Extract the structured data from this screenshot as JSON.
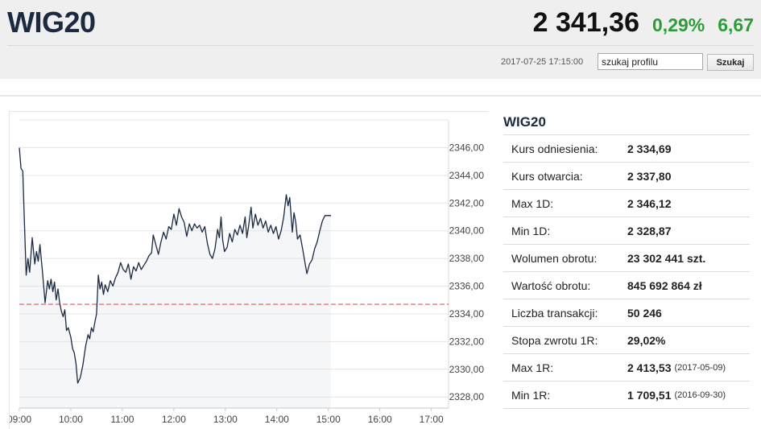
{
  "header": {
    "title": "WIG20",
    "price": "2 341,36",
    "change_pct": "0,29%",
    "change_abs": "6,67",
    "timestamp": "2017-07-25 17:15:00",
    "search": {
      "value": "szukaj profilu",
      "button_label": "Szukaj"
    }
  },
  "colors": {
    "positive": "#2e9b3a",
    "line": "#1b2a41",
    "reference": "#e25b5b",
    "area": "#f4f6f8"
  },
  "chart_data": {
    "type": "line",
    "x_ticks": [
      "09:00",
      "10:00",
      "11:00",
      "12:00",
      "13:00",
      "14:00",
      "15:00",
      "16:00",
      "17:00"
    ],
    "y_ticks": [
      "2346,00",
      "2344,00",
      "2342,00",
      "2340,00",
      "2338,00",
      "2336,00",
      "2334,00",
      "2332,00",
      "2330,00",
      "2328,00"
    ],
    "ylim": [
      2327.2,
      2348.0
    ],
    "xlim_minutes": [
      540,
      1040
    ],
    "reference_value": 2334.69,
    "grid": true,
    "series": [
      {
        "values": [
          [
            540,
            2346.0
          ],
          [
            542,
            2344.5
          ],
          [
            544,
            2344.3
          ],
          [
            546,
            2340.5
          ],
          [
            548,
            2336.8
          ],
          [
            550,
            2338.0
          ],
          [
            552,
            2337.0
          ],
          [
            555,
            2339.5
          ],
          [
            558,
            2337.6
          ],
          [
            560,
            2338.5
          ],
          [
            562,
            2337.8
          ],
          [
            564,
            2339.0
          ],
          [
            567,
            2337.0
          ],
          [
            570,
            2334.8
          ],
          [
            573,
            2336.4
          ],
          [
            575,
            2335.8
          ],
          [
            577,
            2336.5
          ],
          [
            579,
            2335.6
          ],
          [
            581,
            2336.3
          ],
          [
            583,
            2335.0
          ],
          [
            585,
            2335.8
          ],
          [
            587,
            2334.8
          ],
          [
            589,
            2334.2
          ],
          [
            591,
            2333.8
          ],
          [
            593,
            2334.3
          ],
          [
            595,
            2332.8
          ],
          [
            597,
            2333.0
          ],
          [
            600,
            2332.3
          ],
          [
            602,
            2331.5
          ],
          [
            604,
            2331.2
          ],
          [
            606,
            2330.4
          ],
          [
            608,
            2329.0
          ],
          [
            611,
            2329.4
          ],
          [
            614,
            2330.3
          ],
          [
            617,
            2331.6
          ],
          [
            620,
            2332.5
          ],
          [
            622,
            2332.2
          ],
          [
            624,
            2333.0
          ],
          [
            626,
            2332.7
          ],
          [
            628,
            2333.4
          ],
          [
            630,
            2334.0
          ],
          [
            632,
            2336.8
          ],
          [
            634,
            2335.8
          ],
          [
            636,
            2336.3
          ],
          [
            638,
            2335.4
          ],
          [
            640,
            2336.1
          ],
          [
            643,
            2335.6
          ],
          [
            646,
            2336.4
          ],
          [
            649,
            2336.0
          ],
          [
            652,
            2336.6
          ],
          [
            655,
            2337.0
          ],
          [
            658,
            2337.7
          ],
          [
            661,
            2337.2
          ],
          [
            664,
            2337.0
          ],
          [
            667,
            2337.6
          ],
          [
            670,
            2336.5
          ],
          [
            673,
            2337.4
          ],
          [
            676,
            2337.1
          ],
          [
            679,
            2337.7
          ],
          [
            682,
            2337.2
          ],
          [
            685,
            2337.5
          ],
          [
            688,
            2337.8
          ],
          [
            691,
            2338.2
          ],
          [
            694,
            2338.4
          ],
          [
            696,
            2339.7
          ],
          [
            699,
            2339.0
          ],
          [
            702,
            2338.3
          ],
          [
            705,
            2339.2
          ],
          [
            708,
            2339.9
          ],
          [
            711,
            2339.4
          ],
          [
            714,
            2340.3
          ],
          [
            717,
            2340.1
          ],
          [
            720,
            2341.2
          ],
          [
            723,
            2340.4
          ],
          [
            726,
            2341.6
          ],
          [
            729,
            2341.0
          ],
          [
            732,
            2340.6
          ],
          [
            735,
            2339.6
          ],
          [
            738,
            2340.5
          ],
          [
            741,
            2340.0
          ],
          [
            744,
            2340.5
          ],
          [
            747,
            2340.2
          ],
          [
            750,
            2340.4
          ],
          [
            753,
            2339.9
          ],
          [
            756,
            2340.3
          ],
          [
            759,
            2339.1
          ],
          [
            762,
            2338.3
          ],
          [
            765,
            2338.0
          ],
          [
            768,
            2338.7
          ],
          [
            771,
            2340.1
          ],
          [
            773,
            2339.5
          ],
          [
            775,
            2341.0
          ],
          [
            777,
            2339.3
          ],
          [
            779,
            2338.5
          ],
          [
            782,
            2338.8
          ],
          [
            785,
            2339.8
          ],
          [
            788,
            2339.2
          ],
          [
            791,
            2340.1
          ],
          [
            794,
            2339.7
          ],
          [
            797,
            2340.4
          ],
          [
            800,
            2339.8
          ],
          [
            803,
            2341.0
          ],
          [
            805,
            2339.5
          ],
          [
            807,
            2340.3
          ],
          [
            810,
            2341.7
          ],
          [
            812,
            2340.2
          ],
          [
            815,
            2341.2
          ],
          [
            818,
            2340.4
          ],
          [
            821,
            2340.9
          ],
          [
            824,
            2340.2
          ],
          [
            827,
            2340.7
          ],
          [
            830,
            2339.9
          ],
          [
            833,
            2340.4
          ],
          [
            836,
            2339.8
          ],
          [
            839,
            2340.3
          ],
          [
            842,
            2339.4
          ],
          [
            845,
            2340.0
          ],
          [
            848,
            2341.0
          ],
          [
            851,
            2342.6
          ],
          [
            853,
            2341.8
          ],
          [
            855,
            2342.4
          ],
          [
            858,
            2339.9
          ],
          [
            860,
            2341.3
          ],
          [
            862,
            2340.6
          ],
          [
            864,
            2339.4
          ],
          [
            867,
            2339.7
          ],
          [
            870,
            2338.7
          ],
          [
            873,
            2337.6
          ],
          [
            875,
            2336.9
          ],
          [
            878,
            2337.6
          ],
          [
            881,
            2337.9
          ],
          [
            884,
            2338.7
          ],
          [
            887,
            2339.2
          ],
          [
            890,
            2340.0
          ],
          [
            893,
            2340.7
          ],
          [
            896,
            2341.1
          ],
          [
            903,
            2341.1
          ]
        ]
      }
    ]
  },
  "stats": {
    "title": "WIG20",
    "rows": [
      {
        "label": "Kurs odniesienia:",
        "value": "2 334,69",
        "extra": ""
      },
      {
        "label": "Kurs otwarcia:",
        "value": "2 337,80",
        "extra": ""
      },
      {
        "label": "Max 1D:",
        "value": "2 346,12",
        "extra": ""
      },
      {
        "label": "Min 1D:",
        "value": "2 328,87",
        "extra": ""
      },
      {
        "label": "Wolumen obrotu:",
        "value": "23 302 441 szt.",
        "extra": ""
      },
      {
        "label": "Wartość obrotu:",
        "value": "845 692 864 zł",
        "extra": ""
      },
      {
        "label": "Liczba transakcji:",
        "value": "50 246",
        "extra": ""
      },
      {
        "label": "Stopa zwrotu 1R:",
        "value": "29,02%",
        "extra": ""
      },
      {
        "label": "Max 1R:",
        "value": "2 413,53",
        "extra": "(2017-05-09)"
      },
      {
        "label": "Min 1R:",
        "value": "1 709,51",
        "extra": "(2016-09-30)"
      }
    ]
  }
}
